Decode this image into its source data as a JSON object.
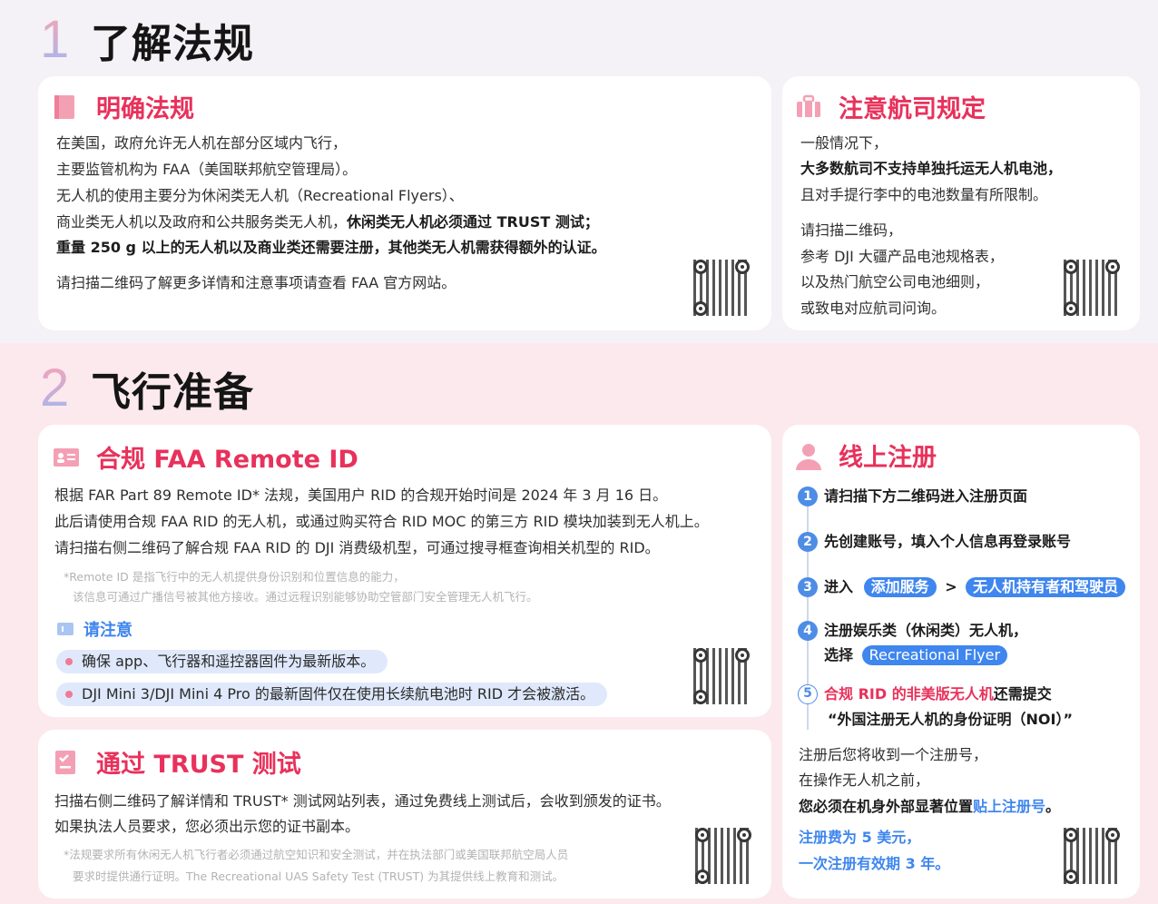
{
  "section1": {
    "number": "1",
    "title": "了解法规",
    "card_left": {
      "title": "明确法规",
      "lines": [
        "在美国，政府允许无人机在部分区域内飞行，",
        "主要监管机构为 FAA（美国联邦航空管理局）。",
        "无人机的使用主要分为休闲类无人机（Recreational Flyers）、",
        "商业类无人机以及政府和公共服务类无人机，"
      ],
      "line4_bold": "休闲类无人机必须通过 TRUST 测试；",
      "line5_bold": "重量 250 g 以上的无人机以及商业类还需要注册，其他类无人机需获得额外的认证。",
      "line6": "请扫描二维码了解更多详情和注意事项请查看 FAA 官方网站。"
    },
    "card_right": {
      "title": "注意航司规定",
      "line1": "一般情况下，",
      "line2_bold": "大多数航司不支持单独托运无人机电池，",
      "line3": "且对手提行李中的电池数量有所限制。",
      "line4": "请扫描二维码，",
      "line5": "参考 DJI 大疆产品电池规格表，",
      "line6": "以及热门航空公司电池细则，",
      "line7": "或致电对应航司问询。"
    }
  },
  "section2": {
    "number": "2",
    "title": "飞行准备",
    "card_rid": {
      "title": "合规 FAA Remote ID",
      "lines": [
        "根据 FAR Part 89 Remote ID* 法规，美国用户 RID 的合规开始时间是 2024 年 3 月 16 日。",
        "此后请使用合规 FAA RID 的无人机，或通过购买符合 RID MOC 的第三方 RID 模块加装到无人机上。",
        "请扫描右侧二维码了解合规 FAA RID 的 DJI 消费级机型，可通过搜寻框查询相关机型的 RID。"
      ],
      "note1": "*Remote ID 是指飞行中的无人机提供身份识别和位置信息的能力，",
      "note2": "该信息可通过广播信号被其他方接收。通过远程识别能够协助空管部门安全管理无人机飞行。",
      "notice_title": "请注意",
      "bullets": [
        "确保 app、飞行器和遥控器固件为最新版本。",
        "DJI Mini 3/DJI Mini 4 Pro 的最新固件仅在使用长续航电池时 RID 才会被激活。"
      ]
    },
    "card_trust": {
      "title": "通过 TRUST 测试",
      "line1": "扫描右侧二维码了解详情和 TRUST* 测试网站列表，通过免费线上测试后，会收到颁发的证书。",
      "line2": "如果执法人员要求，您必须出示您的证书副本。",
      "note1": "*法规要求所有休闲无人机飞行者必须通过航空知识和安全测试，并在执法部门或美国联邦航空局人员",
      "note2": "要求时提供通行证明。The Recreational UAS Safety Test (TRUST) 为其提供线上教育和测试。"
    },
    "card_register": {
      "title": "线上注册",
      "steps": [
        {
          "num": "1",
          "text": "请扫描下方二维码进入注册页面"
        },
        {
          "num": "2",
          "text": "先创建账号，填入个人信息再登录账号"
        },
        {
          "num": "3",
          "prefix": "进入",
          "tag1": "添加服务",
          "sep": ">",
          "tag2": "无人机持有者和驾驶员"
        },
        {
          "num": "4",
          "text": "注册娱乐类（休闲类）无人机，",
          "prefix2": "选择",
          "tag": "Recreational Flyer"
        },
        {
          "num": "5",
          "red": "合规 RID 的非美版无人机",
          "text": "还需提交",
          "text2": "“外国注册无人机的身份证明（NOI）”"
        }
      ],
      "after1": "注册后您将收到一个注册号，",
      "after2": "在操作无人机之前，",
      "after3_bold": "您必须在机身外部显著位置",
      "after3_blue": "贴上注册号",
      "after3_end": "。",
      "fee1": "注册费为 5 美元，",
      "fee2": "一次注册有效期 3 年。"
    }
  },
  "colors": {
    "accent_red": "#e8315b",
    "accent_blue": "#3f86ee",
    "section2_bg": "#fbe9ee"
  }
}
